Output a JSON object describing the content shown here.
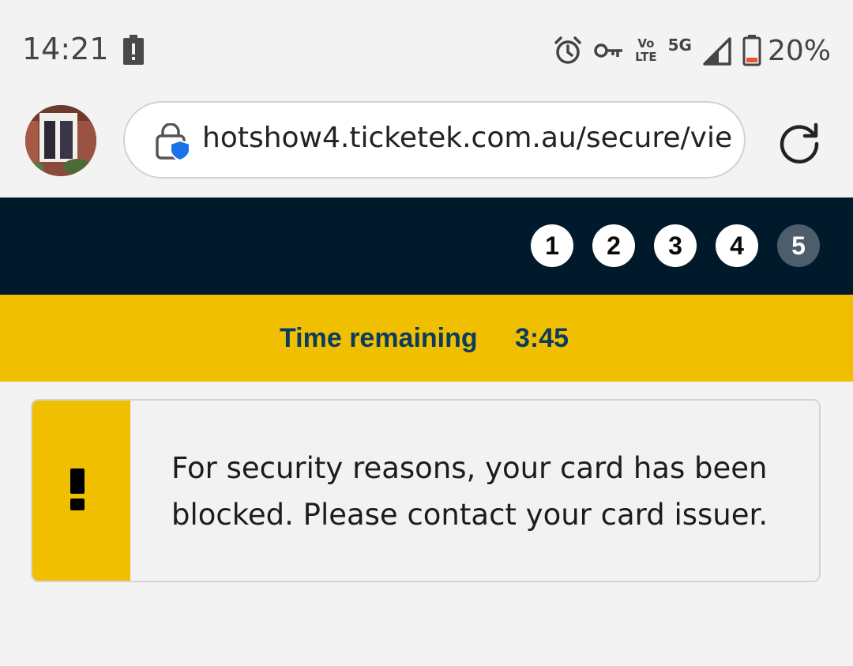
{
  "status_bar": {
    "time": "14:21",
    "network_volte_top": "Vo",
    "network_volte_bottom": "LTE",
    "network_type": "5G",
    "battery_percent": "20%",
    "icons": [
      "alert-icon",
      "alarm-icon",
      "vpn-key-icon",
      "volte-icon",
      "signal-icon",
      "battery-icon"
    ]
  },
  "browser": {
    "url": "hotshow4.ticketek.com.au/secure/vie",
    "icons": [
      "avatar",
      "secure-lock-icon",
      "reload-icon"
    ]
  },
  "steps": {
    "items": [
      "1",
      "2",
      "3",
      "4",
      "5"
    ],
    "active_index": 4
  },
  "timer": {
    "label": "Time remaining",
    "value": "3:45"
  },
  "alert": {
    "message": "For security reasons, your card has been blocked. Please contact your card issuer.",
    "icon": "exclamation-icon"
  },
  "colors": {
    "header_bg": "#001a2b",
    "accent_yellow": "#f0bf00",
    "timer_text": "#0b3c5f",
    "step_active_bg": "#4d5d6b",
    "lock_shield_blue": "#1a73e8"
  }
}
